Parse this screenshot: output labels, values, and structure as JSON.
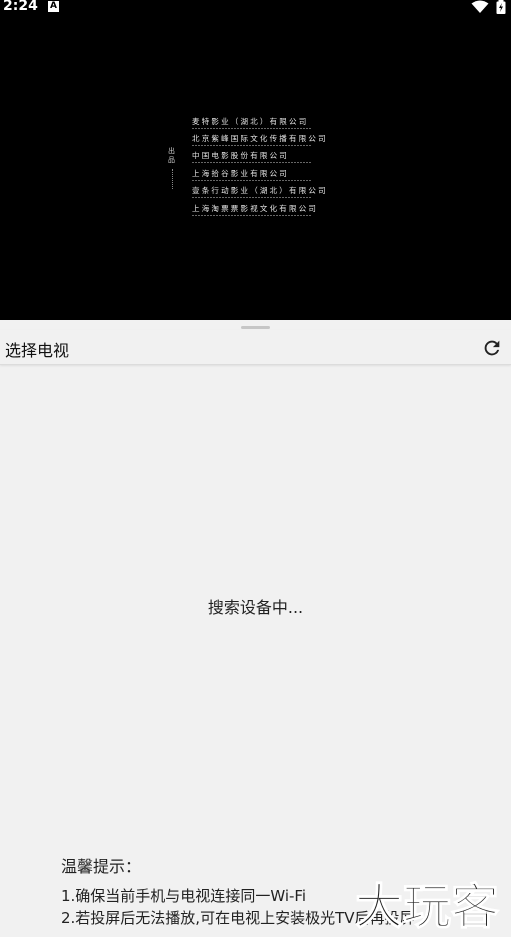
{
  "status_bar": {
    "time": "2:24",
    "notification_icon": "A",
    "icons": [
      "wifi-icon",
      "battery-charging-icon"
    ]
  },
  "video": {
    "vertical_label": "出品",
    "credits": [
      "麦特影业（湖北）有限公司",
      "北京紫峰国际文化传播有限公司",
      "中国电影股份有限公司",
      "上海拾谷影业有限公司",
      "壹条行动影业（湖北）有限公司",
      "上海淘票票影视文化有限公司"
    ]
  },
  "panel": {
    "title": "选择电视",
    "refresh_icon": "refresh-icon",
    "status": "搜索设备中...",
    "tips_title": "温馨提示：",
    "tips": [
      "1.确保当前手机与电视连接同一Wi-Fi",
      "2.若投屏后无法播放,可在电视上安装极光TV后再投屏"
    ]
  },
  "watermark": {
    "text": "大玩客"
  },
  "colors": {
    "video_bg": "#000000",
    "sheet_bg": "#f1f1f1",
    "text": "#222222"
  }
}
